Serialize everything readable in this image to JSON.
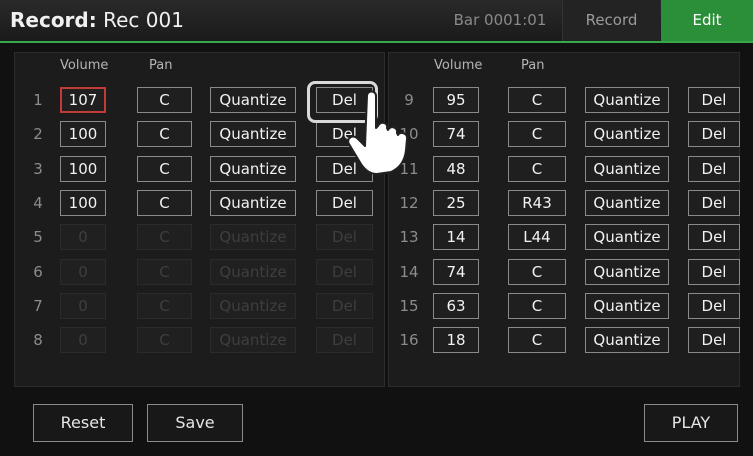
{
  "header": {
    "title_prefix": "Record:",
    "title_name": " Rec 001",
    "bar_position": "Bar 0001:01",
    "tab_record": "Record",
    "tab_edit": "Edit"
  },
  "columns": {
    "volume": "Volume",
    "pan": "Pan"
  },
  "tracks_left": [
    {
      "num": "1",
      "volume": "107",
      "pan": "C",
      "quantize": "Quantize",
      "del": "Del",
      "enabled": true,
      "selected": true
    },
    {
      "num": "2",
      "volume": "100",
      "pan": "C",
      "quantize": "Quantize",
      "del": "Del",
      "enabled": true
    },
    {
      "num": "3",
      "volume": "100",
      "pan": "C",
      "quantize": "Quantize",
      "del": "Del",
      "enabled": true
    },
    {
      "num": "4",
      "volume": "100",
      "pan": "C",
      "quantize": "Quantize",
      "del": "Del",
      "enabled": true
    },
    {
      "num": "5",
      "volume": "0",
      "pan": "C",
      "quantize": "Quantize",
      "del": "Del",
      "enabled": false
    },
    {
      "num": "6",
      "volume": "0",
      "pan": "C",
      "quantize": "Quantize",
      "del": "Del",
      "enabled": false
    },
    {
      "num": "7",
      "volume": "0",
      "pan": "C",
      "quantize": "Quantize",
      "del": "Del",
      "enabled": false
    },
    {
      "num": "8",
      "volume": "0",
      "pan": "C",
      "quantize": "Quantize",
      "del": "Del",
      "enabled": false
    }
  ],
  "tracks_right": [
    {
      "num": "9",
      "volume": "95",
      "pan": "C",
      "quantize": "Quantize",
      "del": "Del",
      "enabled": true
    },
    {
      "num": "10",
      "volume": "74",
      "pan": "C",
      "quantize": "Quantize",
      "del": "Del",
      "enabled": true
    },
    {
      "num": "11",
      "volume": "48",
      "pan": "C",
      "quantize": "Quantize",
      "del": "Del",
      "enabled": true
    },
    {
      "num": "12",
      "volume": "25",
      "pan": "R43",
      "quantize": "Quantize",
      "del": "Del",
      "enabled": true
    },
    {
      "num": "13",
      "volume": "14",
      "pan": "L44",
      "quantize": "Quantize",
      "del": "Del",
      "enabled": true
    },
    {
      "num": "14",
      "volume": "74",
      "pan": "C",
      "quantize": "Quantize",
      "del": "Del",
      "enabled": true
    },
    {
      "num": "15",
      "volume": "63",
      "pan": "C",
      "quantize": "Quantize",
      "del": "Del",
      "enabled": true
    },
    {
      "num": "16",
      "volume": "18",
      "pan": "C",
      "quantize": "Quantize",
      "del": "Del",
      "enabled": true
    }
  ],
  "footer": {
    "reset": "Reset",
    "save": "Save",
    "play": "PLAY"
  },
  "overlay": {
    "pointer_icon": "pointing-hand-icon",
    "highlighted_control": "Del"
  },
  "colors": {
    "accent": "#2b8f3a",
    "selected_border": "#c33a3a"
  }
}
